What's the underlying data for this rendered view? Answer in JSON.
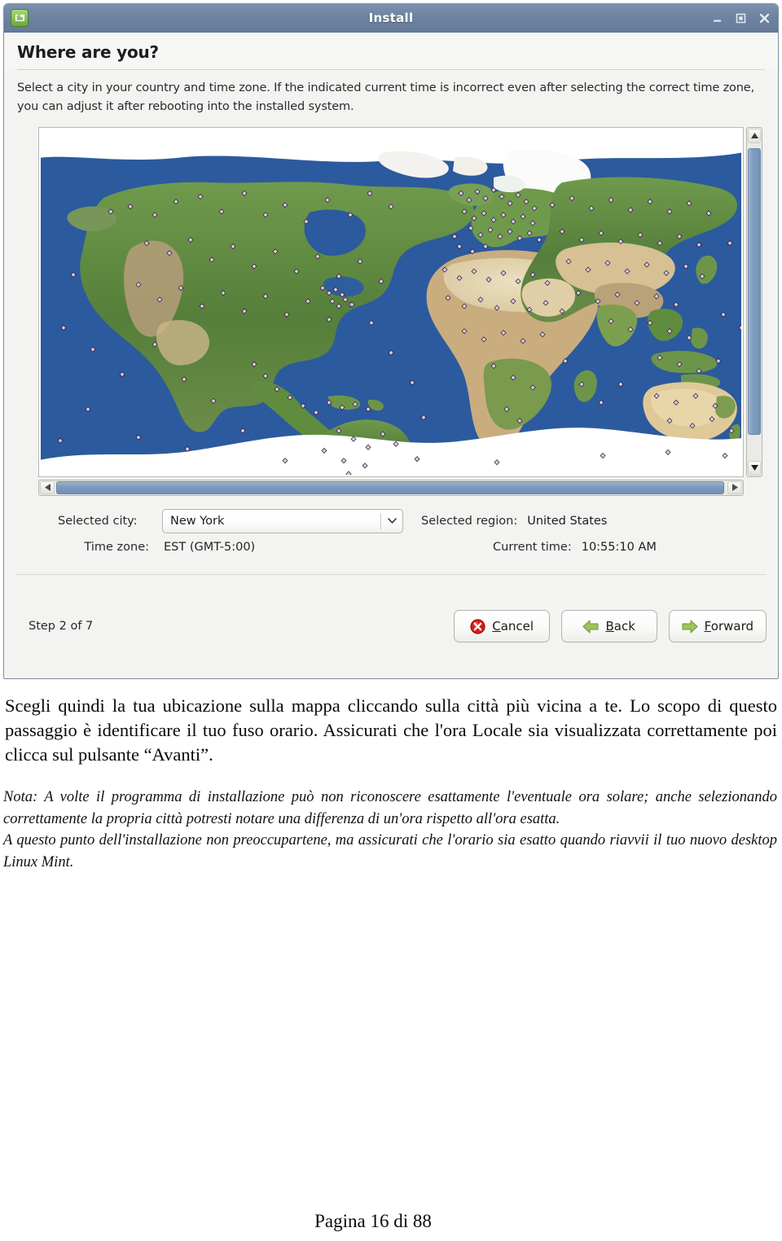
{
  "window": {
    "title": "Install",
    "icon": "linux-mint-logo-icon",
    "controls": {
      "minimize": "minimize-icon",
      "maximize": "maximize-icon",
      "close": "close-icon"
    }
  },
  "page": {
    "heading": "Where are you?",
    "description": "Select a city in your country and time zone. If the indicated current time is incorrect even after selecting the correct time zone, you can adjust it after rebooting into the installed system."
  },
  "map": {
    "name": "world-timezone-map",
    "ocean_color": "#2c5a9e",
    "land_green": "#5c8a40",
    "land_desert": "#e3d6b4",
    "ice_color": "#ffffff",
    "marker_color": "#d8b8e0",
    "scrollbars": {
      "vertical": {
        "up": "scroll-up-arrow-icon",
        "down": "scroll-down-arrow-icon"
      },
      "horizontal": {
        "left": "scroll-left-arrow-icon",
        "right": "scroll-right-arrow-icon"
      }
    }
  },
  "fields": {
    "city_label": "Selected city:",
    "city_value": "New York",
    "city_dropdown_icon": "chevron-down-icon",
    "region_label": "Selected region:",
    "region_value": "United States",
    "timezone_label": "Time zone:",
    "timezone_value": "EST (GMT-5:00)",
    "current_time_label": "Current time:",
    "current_time_value": "10:55:10 AM"
  },
  "footer": {
    "step": "Step 2 of 7",
    "buttons": [
      {
        "id": "cancel",
        "label_before": "",
        "mnemonic": "C",
        "label_after": "ancel",
        "icon": "error-circle-x-icon",
        "accent": "#cc1111"
      },
      {
        "id": "back",
        "label_before": "",
        "mnemonic": "B",
        "label_after": "ack",
        "icon": "arrow-left-icon",
        "accent": "#8cb84a"
      },
      {
        "id": "forward",
        "label_before": "",
        "mnemonic": "F",
        "label_after": "orward",
        "icon": "arrow-right-icon",
        "accent": "#8cb84a"
      }
    ]
  },
  "document": {
    "paragraph_main": "Scegli quindi la tua ubicazione sulla mappa cliccando sulla città più vicina a te. Lo scopo di questo passaggio è identificare il tuo fuso orario. Assicurati che l'ora Locale sia visualizzata correttamente poi clicca sul pulsante “Avanti”.",
    "note_paragraph_1": "Nota: A volte il programma di installazione può non riconoscere esattamente l'eventuale ora solare; anche selezionando correttamente la propria città potresti notare una differenza di un'ora rispetto all'ora esatta.",
    "note_paragraph_2": "A questo punto dell'installazione non preoccupartene, ma assicurati che l'orario sia esatto quando riavvii il tuo nuovo desktop Linux Mint.",
    "page_footer": "Pagina 16 di 88"
  }
}
